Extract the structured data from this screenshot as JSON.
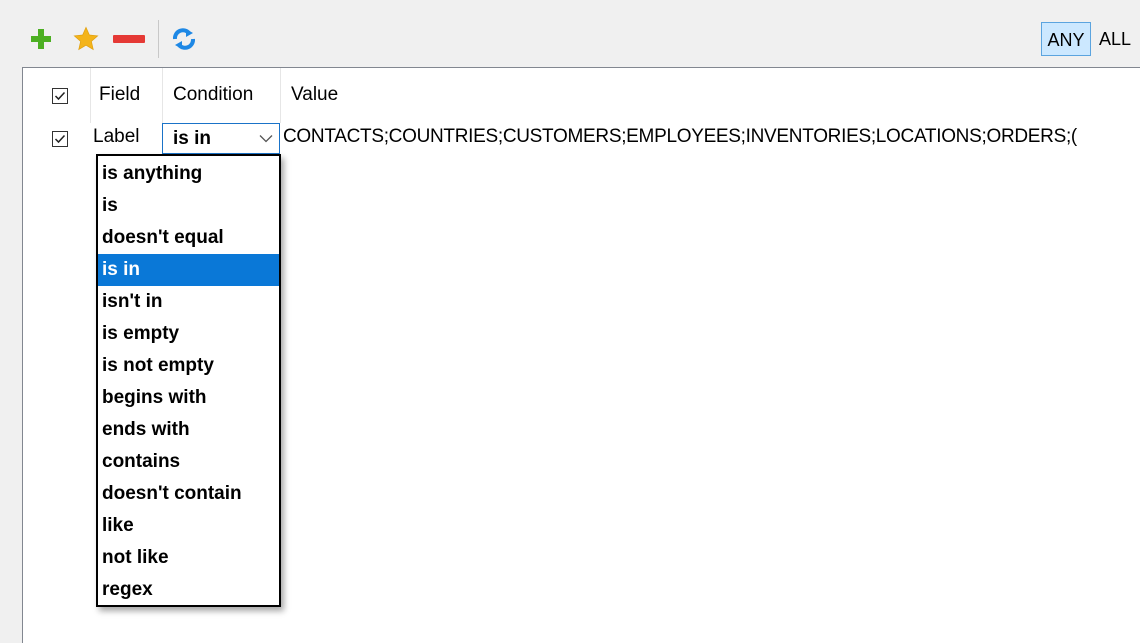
{
  "toolbar": {
    "icons": [
      "plus-icon",
      "star-icon",
      "minus-icon",
      "refresh-icon"
    ],
    "colors": {
      "plus": "#4caf22",
      "star": "#f4b41a",
      "minus": "#e53935",
      "refresh": "#1e88e5"
    },
    "mode": {
      "any_label": "ANY",
      "all_label": "ALL",
      "active": "ANY"
    }
  },
  "grid": {
    "headers": {
      "field": "Field",
      "condition": "Condition",
      "value": "Value"
    },
    "header_checked": true,
    "rows": [
      {
        "checked": true,
        "field": "Label",
        "condition": "is in",
        "value": "CONTACTS;COUNTRIES;CUSTOMERS;EMPLOYEES;INVENTORIES;LOCATIONS;ORDERS;("
      }
    ]
  },
  "dropdown": {
    "options": [
      {
        "label": "is anything"
      },
      {
        "label": "is"
      },
      {
        "label": "doesn't equal"
      },
      {
        "label": "is in",
        "selected": true
      },
      {
        "label": "isn't in"
      },
      {
        "label": "is empty"
      },
      {
        "label": "is not empty"
      },
      {
        "label": "begins with"
      },
      {
        "label": "ends with"
      },
      {
        "label": "contains"
      },
      {
        "label": "doesn't contain"
      },
      {
        "label": "like"
      },
      {
        "label": "not like"
      },
      {
        "label": "regex"
      }
    ],
    "selected_color": "#0a78d7"
  }
}
